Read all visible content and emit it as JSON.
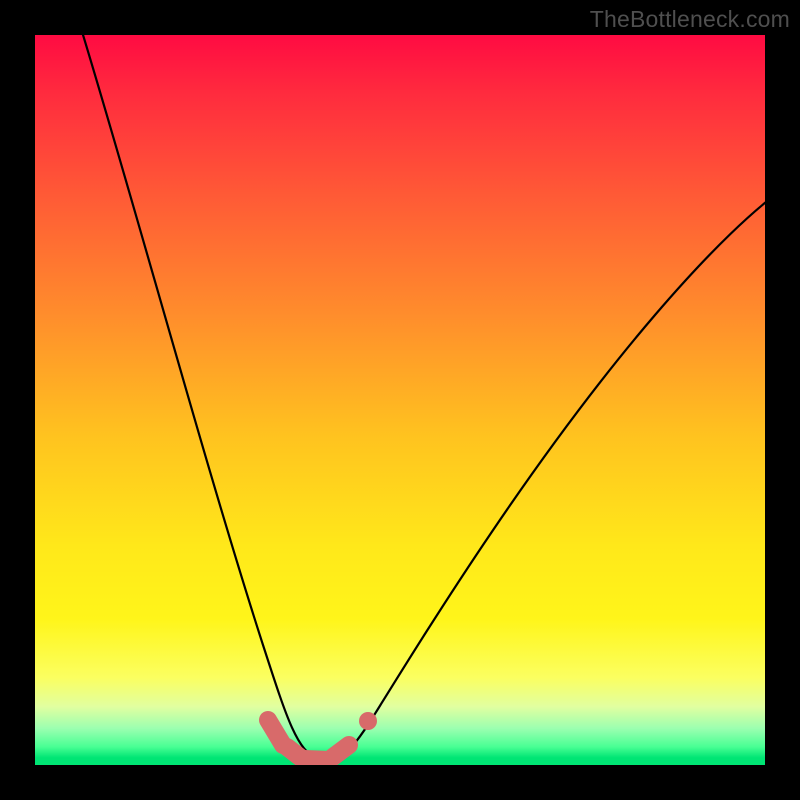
{
  "watermark": "TheBottleneck.com",
  "chart_data": {
    "type": "line",
    "title": "",
    "xlabel": "",
    "ylabel": "",
    "xlim": [
      0,
      100
    ],
    "ylim": [
      0,
      100
    ],
    "grid": false,
    "series": [
      {
        "name": "bottleneck-curve",
        "x": [
          5,
          10,
          15,
          20,
          25,
          28,
          30,
          32,
          34,
          36,
          38,
          40,
          42,
          45,
          50,
          55,
          60,
          65,
          70,
          75,
          80,
          85,
          90,
          95,
          100
        ],
        "y": [
          100,
          80,
          61,
          43,
          26,
          17,
          11,
          6,
          3,
          1,
          0,
          0,
          1,
          4,
          13,
          24,
          35,
          45,
          54,
          62,
          68,
          73,
          77,
          80,
          82
        ]
      }
    ],
    "marker_band": {
      "name": "optimum-markers",
      "x": [
        32,
        33.5,
        35,
        37,
        39,
        41,
        42.5,
        44
      ],
      "y": [
        4,
        2,
        1,
        0,
        0,
        1,
        2.5,
        5
      ]
    },
    "colors": {
      "curve": "#000000",
      "marker": "#d86a6a",
      "gradient_top": "#ff0b42",
      "gradient_mid": "#ffe81a",
      "gradient_bot": "#00e574"
    }
  }
}
